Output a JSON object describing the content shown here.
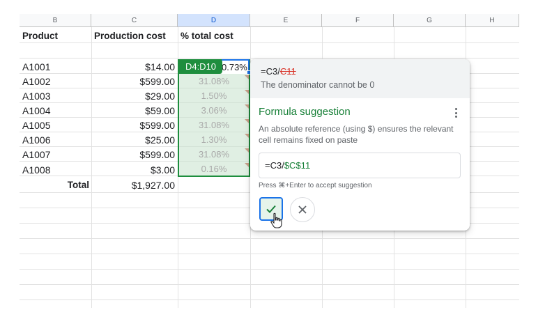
{
  "columns": [
    "B",
    "C",
    "D",
    "E",
    "F",
    "G",
    "H"
  ],
  "headers": {
    "product": "Product",
    "cost": "Production cost",
    "pct": "% total cost"
  },
  "rows": [
    {
      "product": "A1001",
      "cost": "$14.00",
      "pct": "0.73%"
    },
    {
      "product": "A1002",
      "cost": "$599.00",
      "pct": "31.08%"
    },
    {
      "product": "A1003",
      "cost": "$29.00",
      "pct": "1.50%"
    },
    {
      "product": "A1004",
      "cost": "$59.00",
      "pct": "3.06%"
    },
    {
      "product": "A1005",
      "cost": "$599.00",
      "pct": "31.08%"
    },
    {
      "product": "A1006",
      "cost": "$25.00",
      "pct": "1.30%"
    },
    {
      "product": "A1007",
      "cost": "$599.00",
      "pct": "31.08%"
    },
    {
      "product": "A1008",
      "cost": "$3.00",
      "pct": "0.16%"
    }
  ],
  "total": {
    "label": "Total",
    "value": "$1,927.00"
  },
  "selection": {
    "range_label": "D4:D10",
    "d4_visible": "0.73%"
  },
  "popup": {
    "error_formula_prefix": "=C3/",
    "error_formula_bad": "C11",
    "error_message": "The denominator cannot be 0",
    "title": "Formula suggestion",
    "description": "An absolute reference (using $) ensures the relevant cell remains fixed on paste",
    "suggestion_prefix": "=C3/",
    "suggestion_fix": "$C$11",
    "hint": "Press ⌘+Enter to accept suggestion",
    "accept_icon": "check-icon",
    "reject_icon": "close-icon",
    "more_icon": "more-vert-icon"
  },
  "colors": {
    "accent_green": "#188038",
    "selection_green": "#1e8e3e",
    "error_red": "#d93025",
    "focus_blue": "#1a73e8"
  }
}
